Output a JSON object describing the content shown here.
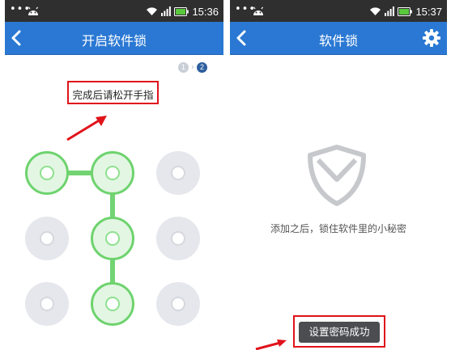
{
  "left_screen": {
    "status_bar": {
      "dots": "•••",
      "time": "15:36"
    },
    "title": "开启软件锁",
    "steps": [
      "1",
      "2"
    ],
    "instruction": "完成后请松开手指",
    "pattern": {
      "grid_size": 3,
      "selected_nodes": [
        1,
        2,
        5,
        8
      ],
      "node_count": 9
    }
  },
  "right_screen": {
    "status_bar": {
      "dots": "•••",
      "time": "15:37"
    },
    "title": "软件锁",
    "empty_message": "添加之后，锁住软件里的小秘密",
    "toast": "设置密码成功"
  },
  "colors": {
    "nav_blue": "#2a78d3",
    "status_bar": "#2f2f2f",
    "highlight_red": "#e0121a",
    "pattern_green": "#6ed36e"
  },
  "icons": [
    "android-icon",
    "wifi-icon",
    "signal-icon",
    "battery-icon",
    "back-icon",
    "gear-icon",
    "shield-icon"
  ]
}
